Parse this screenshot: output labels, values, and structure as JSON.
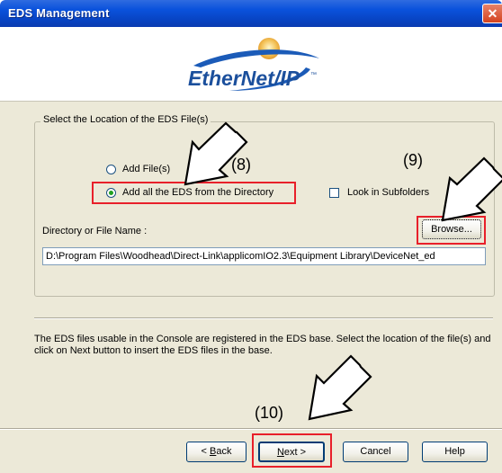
{
  "window": {
    "title": "EDS Management",
    "close_glyph": "✕"
  },
  "logo": {
    "text": "EtherNet/IP",
    "trademark": "™",
    "icon": "ethernet-ip-logo"
  },
  "location_group": {
    "legend": "Select the Location of the EDS File(s)",
    "options": [
      {
        "label": "Add File(s)",
        "selected": false
      },
      {
        "label": "Add all the EDS from the Directory",
        "selected": true
      }
    ],
    "look_in_subfolders": {
      "label": "Look in Subfolders",
      "checked": false
    },
    "directory_label": "Directory or File Name :",
    "directory_value": "D:\\Program Files\\Woodhead\\Direct-Link\\applicomIO2.3\\Equipment Library\\DeviceNet_ed",
    "browse_label": "Browse..."
  },
  "info_text": "The EDS files usable in the Console are registered in the EDS base. Select the location of the file(s) and click on Next button to insert the EDS files in the base.",
  "buttons": {
    "back_prefix": "< ",
    "back_key": "B",
    "back_rest": "ack",
    "next_key": "N",
    "next_rest": "ext >",
    "cancel": "Cancel",
    "help": "Help"
  },
  "annotations": {
    "step8": "(8)",
    "step9": "(9)",
    "step10": "(10)"
  },
  "colors": {
    "titlebar": "#0a52dc",
    "dialog_bg": "#ece9d8",
    "highlight": "#e8202a"
  }
}
